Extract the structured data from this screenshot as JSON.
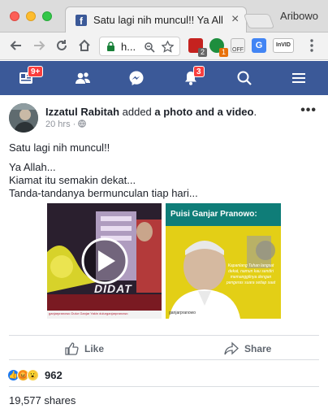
{
  "browser": {
    "tab_title": "Satu lagi nih muncul!! Ya Allah...",
    "tab_favicon": "f",
    "profile_name": "Aribowo",
    "omnibox_text": "h..."
  },
  "extensions": {
    "ext2_badge": "2",
    "ext3_badge": "1",
    "ext4_label": "OFF",
    "ext6_label": "InVID"
  },
  "fb_nav": {
    "home_badge": "9+",
    "notifications_badge": "3"
  },
  "post": {
    "author": "Izzatul Rabitah",
    "action_text": " added ",
    "object_text": "a photo and a video",
    "punct": ".",
    "time": "20 hrs",
    "sep": "·",
    "line1": "Satu lagi nih muncul!!",
    "line2": "Ya Allah...",
    "line3": "Kiamat itu semakin dekat...",
    "line4": "Tanda-tandanya bermunculan tiap hari...",
    "like_label": "Like",
    "share_label": "Share",
    "reaction_count": "962",
    "shares_text": "19,577 shares"
  },
  "media": {
    "left_caption": "DIDAT",
    "left_footer": "ganjarpranowo   Dulur Ganjar Yakin   dulurganjarpranowo",
    "right_title": "Puisi Ganjar Pranowo:",
    "right_quote": "Kapanlang Tuhan langsat dekat, namun kau sendiri memanggilnya dengan pengeras suara setiap saat",
    "right_footer": "ganjarpranowo"
  },
  "colors": {
    "facebook_blue": "#3b5998",
    "notification_red": "#fa3e3e",
    "video_bg": "#28202b",
    "poster_yellow": "#e8d31c"
  }
}
